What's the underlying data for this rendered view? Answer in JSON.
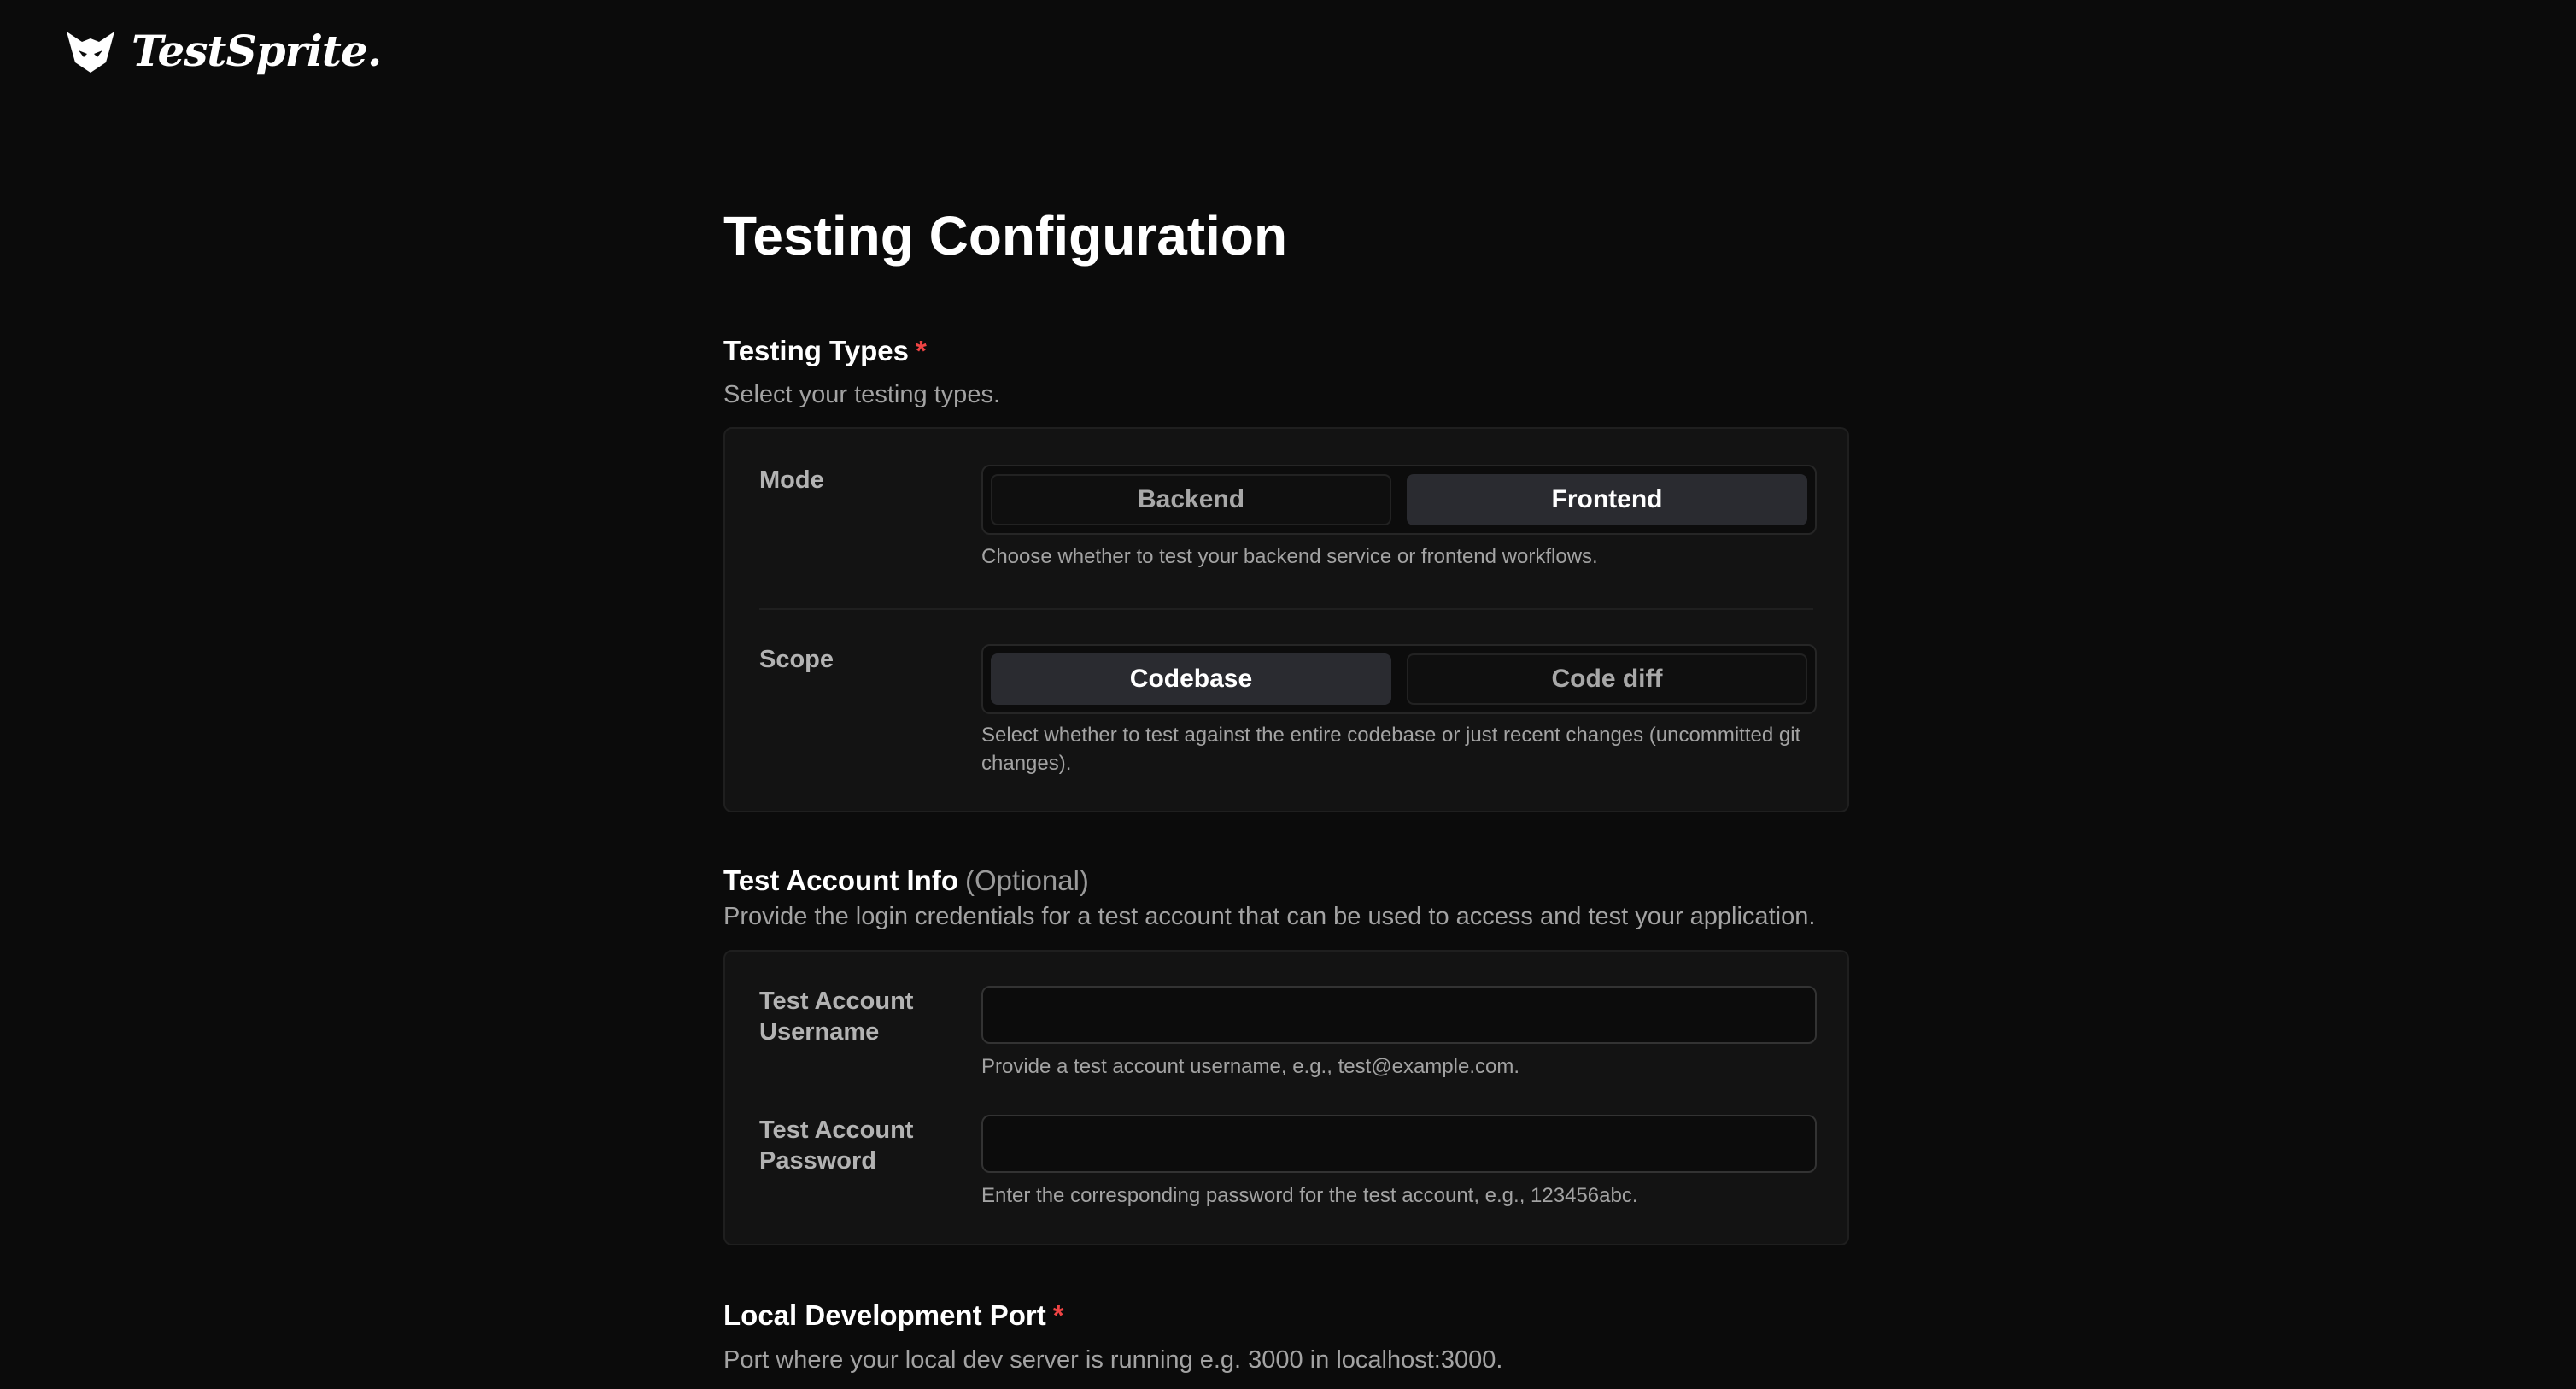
{
  "header": {
    "logo_text": "TestSprite."
  },
  "page": {
    "title": "Testing Configuration"
  },
  "testing_types": {
    "title": "Testing Types",
    "required_mark": "*",
    "description": "Select your testing types.",
    "mode": {
      "label": "Mode",
      "options": [
        "Backend",
        "Frontend"
      ],
      "selected": "Frontend",
      "hint": "Choose whether to test your backend service or frontend workflows."
    },
    "scope": {
      "label": "Scope",
      "options": [
        "Codebase",
        "Code diff"
      ],
      "selected": "Codebase",
      "hint": "Select whether to test against the entire codebase or just recent changes (uncommitted git changes)."
    }
  },
  "test_account": {
    "title": "Test Account Info",
    "optional_label": "(Optional)",
    "description": "Provide the login credentials for a test account that can be used to access and test your application.",
    "username": {
      "label": "Test Account Username",
      "value": "",
      "hint": "Provide a test account username, e.g., test@example.com."
    },
    "password": {
      "label": "Test Account Password",
      "value": "",
      "hint": "Enter the corresponding password for the test account, e.g., 123456abc."
    }
  },
  "local_port": {
    "title": "Local Development Port",
    "required_mark": "*",
    "description": "Port where your local dev server is running e.g. 3000 in localhost:3000."
  },
  "colors": {
    "background": "#0b0b0b",
    "card": "#131313",
    "required": "#ef4444",
    "active_segment": "#2a2b30"
  }
}
